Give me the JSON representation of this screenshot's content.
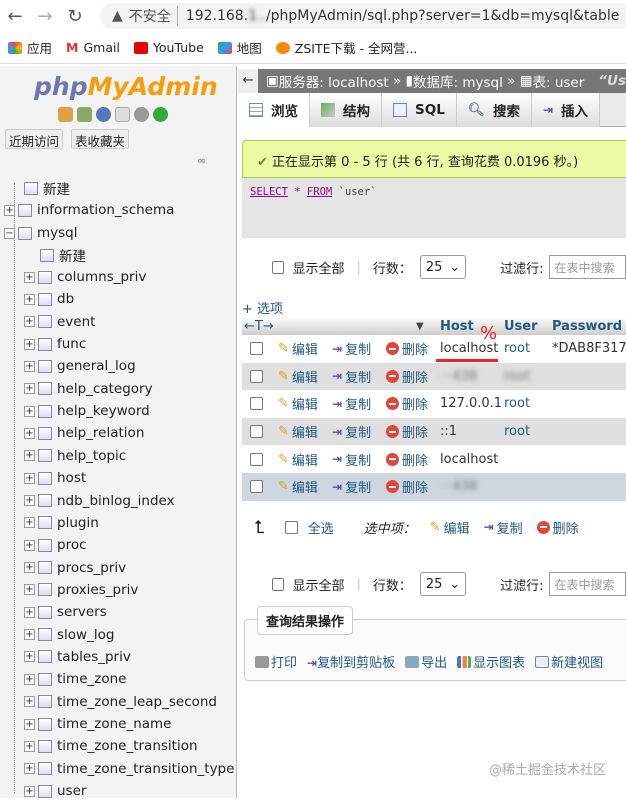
{
  "browser": {
    "url_prefix": "192.168.",
    "url_suffix": "/phpMyAdmin/sql.php?server=1&db=mysql&table",
    "insecure": "不安全",
    "bookmarks": [
      "应用",
      "Gmail",
      "YouTube",
      "地图",
      "ZSITE下载 - 全网营..."
    ]
  },
  "sidebar": {
    "logo_php": "php",
    "logo_my": "MyAdmin",
    "recent": "近期访问",
    "favorites": "表收藏夹",
    "tree": [
      {
        "label": "新建"
      },
      {
        "label": "information_schema"
      },
      {
        "label": "mysql"
      },
      {
        "label": "新建"
      }
    ],
    "tables": [
      "columns_priv",
      "db",
      "event",
      "func",
      "general_log",
      "help_category",
      "help_keyword",
      "help_relation",
      "help_topic",
      "host",
      "ndb_binlog_index",
      "plugin",
      "proc",
      "procs_priv",
      "proxies_priv",
      "servers",
      "slow_log",
      "tables_priv",
      "time_zone",
      "time_zone_leap_second",
      "time_zone_name",
      "time_zone_transition",
      "time_zone_transition_type",
      "user"
    ]
  },
  "breadcrumb": {
    "server": "服务器: localhost",
    "sep": "»",
    "db": "数据库: mysql",
    "table": "表: user",
    "extra": "“Us"
  },
  "tabs": [
    "浏览",
    "结构",
    "SQL",
    "搜索",
    "插入"
  ],
  "success": "正在显示第 0 - 5 行 (共 6 行, 查询花费 0.0196 秒。)",
  "sql": {
    "select": "SELECT",
    "star": "*",
    "from": "FROM",
    "table": "`user`"
  },
  "controls": {
    "show_all": "显示全部",
    "rows_label": "行数：",
    "rows_value": "25",
    "filter_label": "过滤行:",
    "filter_placeholder": "在表中搜索"
  },
  "options": "+ 选项",
  "columns": [
    "Host",
    "User",
    "Password"
  ],
  "annotation": "%",
  "actions": {
    "edit": "编辑",
    "copy": "复制",
    "delete": "删除"
  },
  "rows": [
    {
      "host": "localhost",
      "user": "root",
      "password": "*DAB8F317"
    },
    {
      "host": "···438",
      "user": "root",
      "password": "",
      "blur": true
    },
    {
      "host": "127.0.0.1",
      "user": "root",
      "password": ""
    },
    {
      "host": "::1",
      "user": "root",
      "password": ""
    },
    {
      "host": "localhost",
      "user": "",
      "password": ""
    },
    {
      "host": "···438",
      "user": "",
      "password": "",
      "blur": true
    }
  ],
  "footer": {
    "select_all": "全选",
    "with_selected": "选中项：",
    "edit": "编辑",
    "copy": "复制",
    "delete": "删除"
  },
  "query_ops": {
    "title": "查询结果操作",
    "items": [
      "打印",
      "复制到剪贴板",
      "导出",
      "显示图表",
      "新建视图"
    ]
  },
  "watermark": "@稀土掘金技术社区"
}
